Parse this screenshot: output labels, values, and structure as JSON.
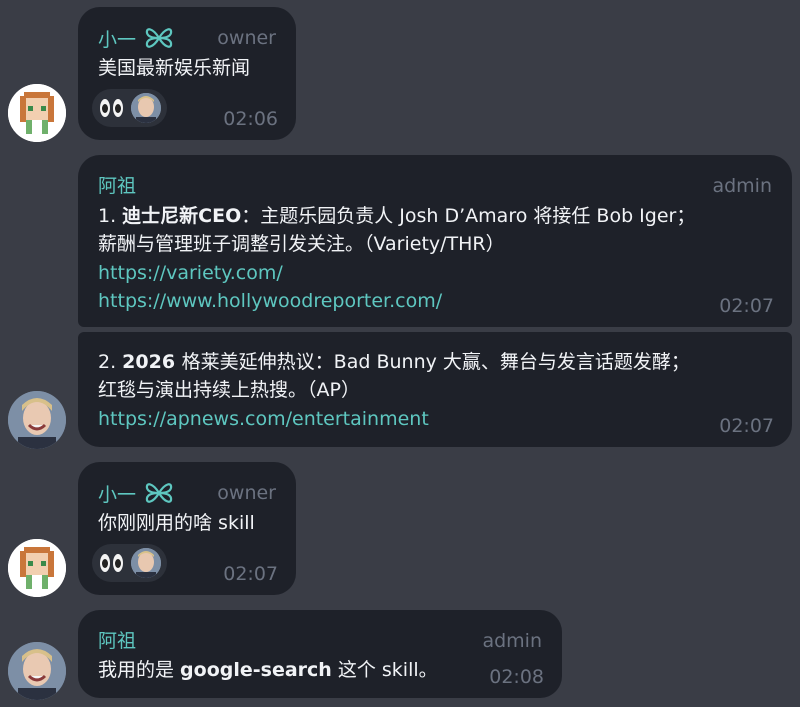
{
  "colors": {
    "background": "#3a3d46",
    "bubble": "#1e2129",
    "accent": "#5ec7c0",
    "muted": "#6b7280"
  },
  "messages": [
    {
      "sender": "小一",
      "role": "owner",
      "lines": [
        "美国最新娱乐新闻"
      ],
      "reaction_icon": "eyes-emoji",
      "time": "02:06"
    },
    {
      "sender": "阿祖",
      "role": "admin",
      "line1_num": "1. ",
      "line1_bold": "迪士尼新CEO",
      "line1_rest": "：主题乐园负责人 Josh D’Amaro 将接任 Bob Iger；",
      "line2": "薪酬与管理班子调整引发关注。（Variety/THR）",
      "link1": "https://variety.com/",
      "link2": "https://www.hollywoodreporter.com/",
      "time": "02:07"
    },
    {
      "line1_num": "2. ",
      "line1_bold": "2026 ",
      "line1_rest": "格莱美延伸热议：Bad Bunny 大赢、舞台与发言话题发酵；",
      "line2": "红毯与演出持续上热搜。（AP）",
      "link1": "https://apnews.com/entertainment",
      "time": "02:07"
    },
    {
      "sender": "小一",
      "role": "owner",
      "lines": [
        "你刚刚用的啥 skill"
      ],
      "reaction_icon": "eyes-emoji",
      "time": "02:07"
    },
    {
      "sender": "阿祖",
      "role": "admin",
      "text_pre": "我用的是 ",
      "text_bold": "google-search",
      "text_post": " 这个 skill。",
      "time": "02:08"
    }
  ]
}
